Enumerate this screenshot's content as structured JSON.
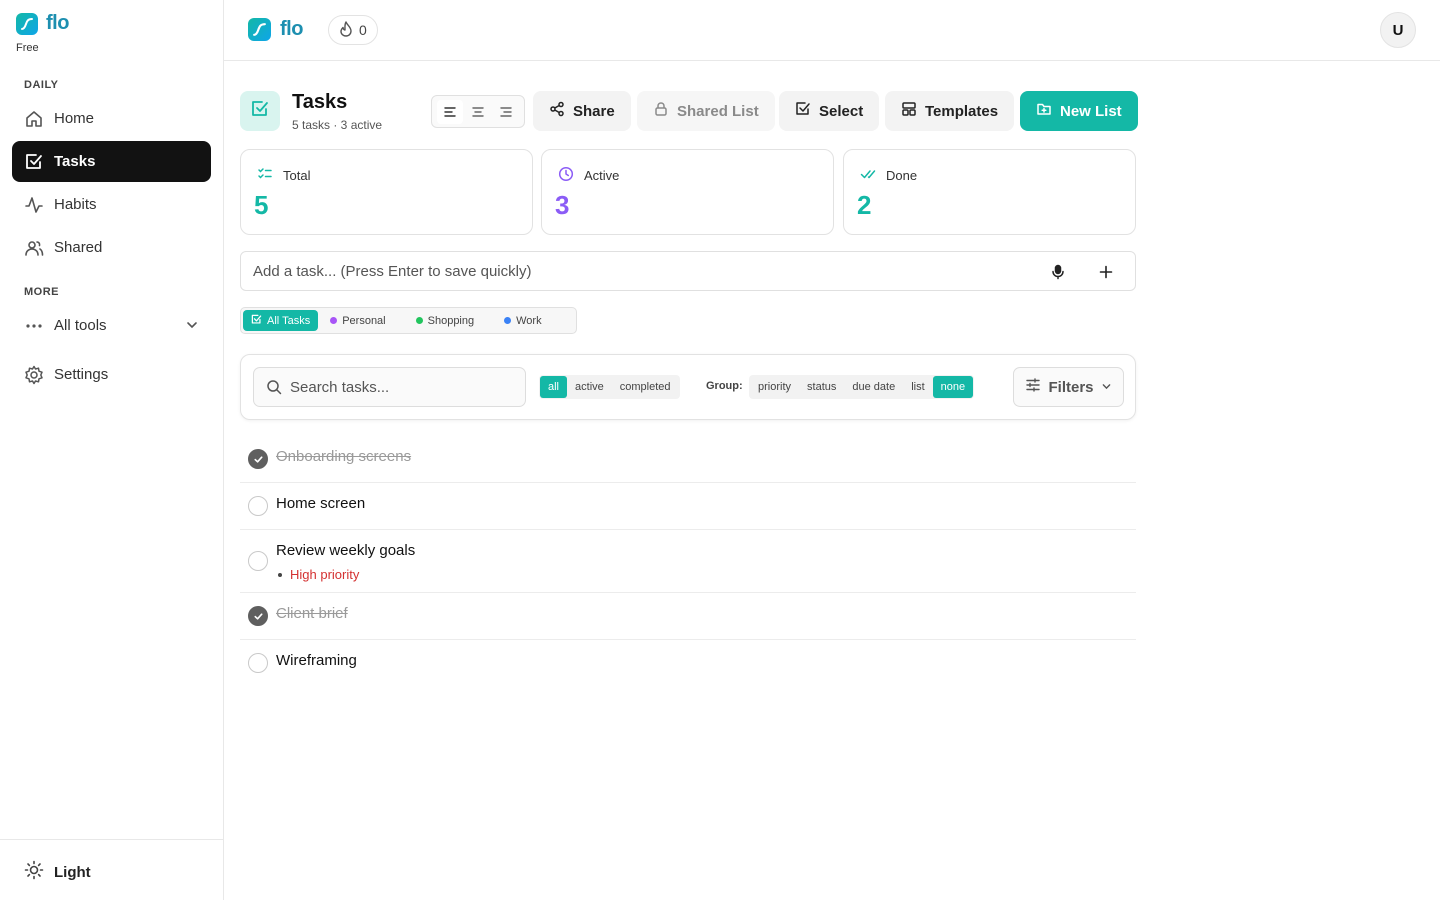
{
  "app": {
    "name": "flo",
    "plan": "Free"
  },
  "colors": {
    "accent": "#14b8a6",
    "total": "#14b8a6",
    "active": "#8b5cf6",
    "done": "#14b8a6",
    "priority_high": "#d43131"
  },
  "sidebar": {
    "sections": {
      "daily": "DAILY",
      "more": "MORE"
    },
    "items": [
      {
        "label": "Home",
        "icon": "home-icon"
      },
      {
        "label": "Tasks",
        "icon": "checkbox-icon",
        "active": true
      },
      {
        "label": "Habits",
        "icon": "activity-icon"
      },
      {
        "label": "Shared",
        "icon": "users-icon"
      },
      {
        "label": "All tools",
        "icon": "more-horizontal-icon"
      },
      {
        "label": "Settings",
        "icon": "gear-icon"
      }
    ],
    "theme_label": "Light"
  },
  "topbar": {
    "brand": "flo",
    "streak_count": "0",
    "avatar_initial": "U"
  },
  "header": {
    "title": "Tasks",
    "subtitle": "5 tasks · 3 active",
    "buttons": {
      "share": "Share",
      "shared_list": "Shared List",
      "select": "Select",
      "templates": "Templates",
      "new_list": "New List"
    }
  },
  "stats": [
    {
      "label": "Total",
      "value": "5"
    },
    {
      "label": "Active",
      "value": "3"
    },
    {
      "label": "Done",
      "value": "2"
    }
  ],
  "add_task": {
    "placeholder": "Add a task... (Press Enter to save quickly)"
  },
  "list_tabs": [
    {
      "label": "All Tasks",
      "active": true
    },
    {
      "label": "Personal",
      "color": "#a855f7"
    },
    {
      "label": "Shopping",
      "color": "#22c55e"
    },
    {
      "label": "Work",
      "color": "#3b82f6"
    }
  ],
  "filters": {
    "search_placeholder": "Search tasks...",
    "status": [
      "all",
      "active",
      "completed"
    ],
    "status_selected": "all",
    "group_label": "Group:",
    "group": [
      "priority",
      "status",
      "due date",
      "list",
      "none"
    ],
    "group_selected": "none",
    "filters_label": "Filters"
  },
  "tasks": [
    {
      "title": "Onboarding screens",
      "done": true
    },
    {
      "title": "Home screen",
      "done": false
    },
    {
      "title": "Review weekly goals",
      "done": false,
      "priority": "High priority"
    },
    {
      "title": "Client brief",
      "done": true
    },
    {
      "title": "Wireframing",
      "done": false
    }
  ]
}
